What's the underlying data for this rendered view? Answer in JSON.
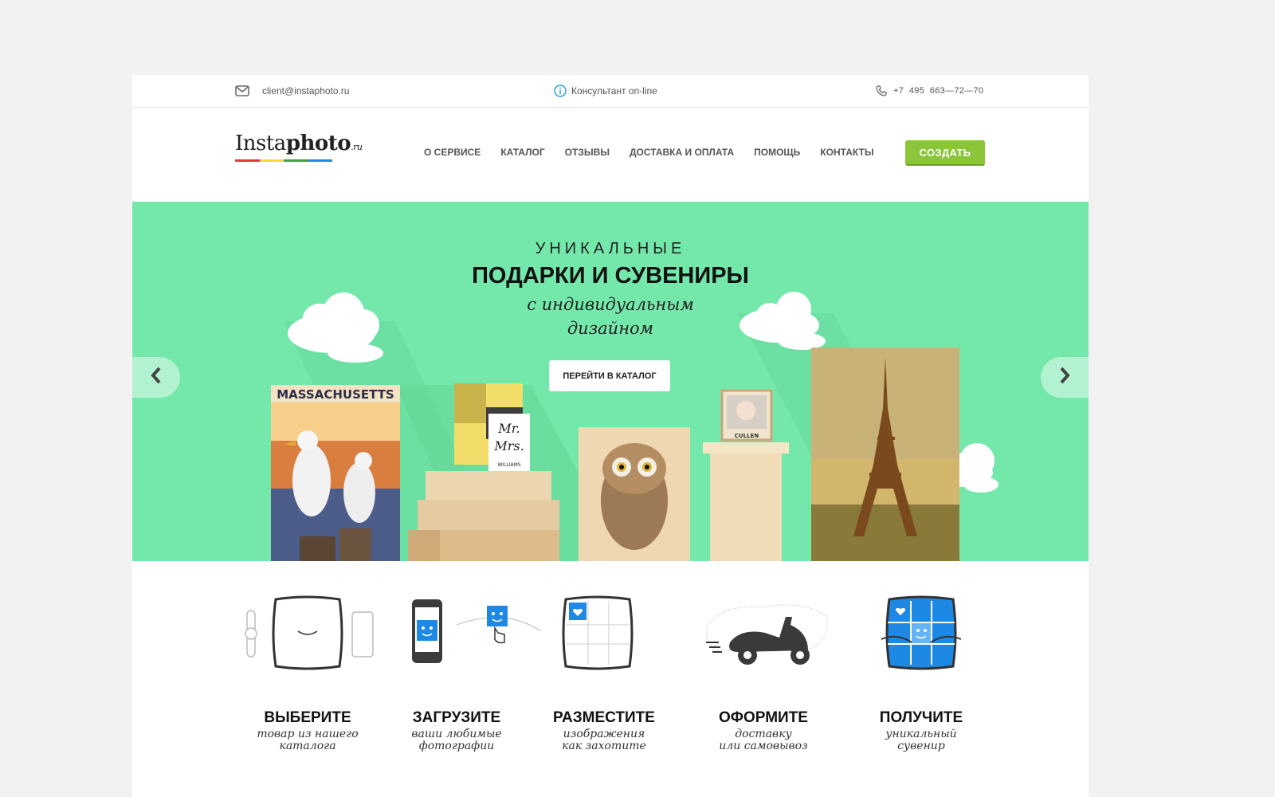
{
  "topbar": {
    "email": "client@instaphoto.ru",
    "consultant": "Консультант on-line",
    "phone": "+7  495  663—72—70"
  },
  "logo": {
    "part1": "Insta",
    "part2": "photo",
    "suffix": ".ru",
    "colors": [
      "#e53935",
      "#fdd835",
      "#43a047",
      "#1e88e5"
    ]
  },
  "nav": {
    "items": [
      {
        "label": "О СЕРВИСЕ"
      },
      {
        "label": "КАТАЛОГ"
      },
      {
        "label": "ОТЗЫВЫ"
      },
      {
        "label": "ДОСТАВКА И ОПЛАТА"
      },
      {
        "label": "ПОМОЩЬ"
      },
      {
        "label": "КОНТАКТЫ"
      }
    ],
    "create_label": "СОЗДАТЬ"
  },
  "hero": {
    "kicker": "УНИКАЛЬНЫЕ",
    "title": "ПОДАРКИ И СУВЕНИРЫ",
    "subtitle_line1": "с индивидуальным",
    "subtitle_line2": "дизайном",
    "button": "ПЕРЕЙТИ В КАТАЛОГ",
    "poster_text": "MASSACHUSETTS",
    "sign_line1": "Mr.",
    "sign_line2": "Mrs.",
    "sign_name": "WILLIAMS",
    "frame_label": "CULLEN",
    "accent_color": "#74e8aa"
  },
  "steps": [
    {
      "title": "ВЫБЕРИТЕ",
      "line1": "товар из нашего",
      "line2": "каталога"
    },
    {
      "title": "ЗАГРУЗИТЕ",
      "line1": "ваши любимые",
      "line2": "фотографии"
    },
    {
      "title": "РАЗМЕСТИТЕ",
      "line1": "изображения",
      "line2": "как захотите"
    },
    {
      "title": "ОФОРМИТЕ",
      "line1": "доставку",
      "line2": "или самовывоз"
    },
    {
      "title": "ПОЛУЧИТЕ",
      "line1": "уникальный",
      "line2": "сувенир"
    }
  ]
}
